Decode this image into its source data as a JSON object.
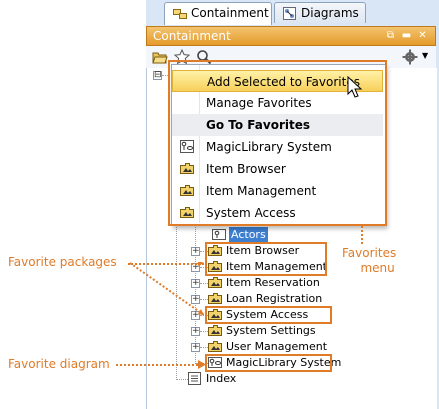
{
  "tabs": [
    {
      "label": "Containment",
      "icon": "containment-icon",
      "active": true
    },
    {
      "label": "Diagrams",
      "icon": "diagrams-icon",
      "active": false
    }
  ],
  "panel": {
    "title": "Containment"
  },
  "toolbar": {
    "icons": [
      "open-folder-icon",
      "star-icon",
      "search-icon",
      "gear-icon"
    ]
  },
  "menu": {
    "items": [
      {
        "label": "Add Selected to Favorites",
        "highlighted": true
      },
      {
        "label": "Manage Favorites"
      },
      {
        "label": "Go To Favorites",
        "bold": true
      },
      {
        "label": "MagicLibrary System",
        "icon": "diagram-icon"
      },
      {
        "label": "Item Browser",
        "icon": "package-icon"
      },
      {
        "label": "Item Management",
        "icon": "package-icon"
      },
      {
        "label": "System Access",
        "icon": "package-icon"
      }
    ]
  },
  "tree": {
    "root_expander": "⊟",
    "selected": "Actors",
    "items": [
      {
        "label": "Item Browser",
        "favorite": true
      },
      {
        "label": "Item Management",
        "favorite": true
      },
      {
        "label": "Item Reservation"
      },
      {
        "label": "Loan Registration"
      },
      {
        "label": "System Access",
        "favorite": true
      },
      {
        "label": "System Settings"
      },
      {
        "label": "User Management"
      },
      {
        "label": "MagicLibrary System",
        "favorite": true,
        "type": "diagram"
      },
      {
        "label": "Index",
        "type": "index"
      }
    ]
  },
  "annotations": {
    "favorites_menu": [
      "Favorites",
      "menu"
    ],
    "favorite_packages": "Favorite packages",
    "favorite_diagram": "Favorite diagram"
  },
  "colors": {
    "accent": "#e07b28",
    "highlight": "#f7d05a",
    "selected": "#3d7fd1"
  }
}
